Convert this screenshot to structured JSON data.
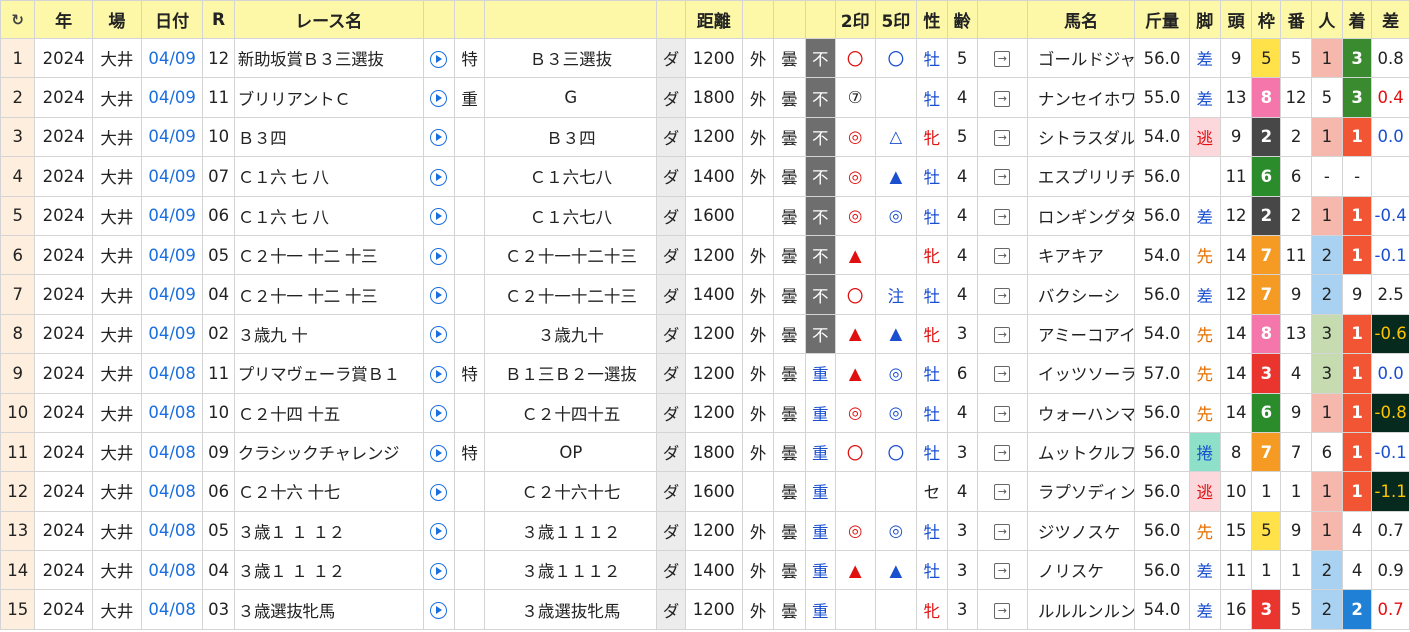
{
  "headers": {
    "refresh": "↻",
    "year": "年",
    "place": "場",
    "date": "日付",
    "race_no": "R",
    "race_name": "レース名",
    "distance": "距離",
    "mark2": "2印",
    "mark5": "5印",
    "sex": "性",
    "age": "齢",
    "horse_name": "馬名",
    "weight": "斤量",
    "leg": "脚",
    "heads": "頭",
    "waku": "枠",
    "ban": "番",
    "ninki": "人",
    "chaku": "着",
    "diff": "差"
  },
  "icons": {
    "play": "play-circle-icon",
    "link": "external-link-icon"
  },
  "rows": [
    {
      "idx": "1",
      "year": "2024",
      "place": "大井",
      "date": "04/09",
      "rno": "12",
      "rname": "新助坂賞Ｂ３三選抜",
      "flag": "特",
      "cls": "Ｂ３三選抜",
      "surf": "ダ",
      "dist": "1200",
      "course": "外",
      "weather": "曇",
      "baba": "不",
      "m2": "〇",
      "m2c": "m-red",
      "m5": "〇",
      "m5c": "m-blue",
      "sex": "牡",
      "age": "5",
      "horse": "ゴールドジャッジ",
      "kin": "56.0",
      "leg": "差",
      "heads": "9",
      "waku": "5",
      "ban": "5",
      "ninki": "1",
      "chaku": "3",
      "diff": "0.8"
    },
    {
      "idx": "2",
      "year": "2024",
      "place": "大井",
      "date": "04/09",
      "rno": "11",
      "rname": "ブリリアントＣ",
      "flag": "重",
      "cls": "G",
      "surf": "ダ",
      "dist": "1800",
      "course": "外",
      "weather": "曇",
      "baba": "不",
      "m2": "⑦",
      "m2c": "",
      "m5": "",
      "m5c": "",
      "sex": "牡",
      "age": "4",
      "horse": "ナンセイホワイト",
      "kin": "55.0",
      "leg": "差",
      "heads": "13",
      "waku": "8",
      "ban": "12",
      "ninki": "5",
      "chaku": "3",
      "diff": "0.4"
    },
    {
      "idx": "3",
      "year": "2024",
      "place": "大井",
      "date": "04/09",
      "rno": "10",
      "rname": "Ｂ３四",
      "flag": "",
      "cls": "Ｂ３四",
      "surf": "ダ",
      "dist": "1200",
      "course": "外",
      "weather": "曇",
      "baba": "不",
      "m2": "◎",
      "m2c": "m-red",
      "m5": "△",
      "m5c": "m-blue",
      "sex": "牝",
      "age": "5",
      "horse": "シトラスダル",
      "kin": "54.0",
      "leg": "逃",
      "heads": "9",
      "waku": "2",
      "ban": "2",
      "ninki": "1",
      "chaku": "1",
      "diff": "0.0"
    },
    {
      "idx": "4",
      "year": "2024",
      "place": "大井",
      "date": "04/09",
      "rno": "07",
      "rname": "Ｃ１六 七 八",
      "flag": "",
      "cls": "Ｃ１六七八",
      "surf": "ダ",
      "dist": "1400",
      "course": "外",
      "weather": "曇",
      "baba": "不",
      "m2": "◎",
      "m2c": "m-red",
      "m5": "▲",
      "m5c": "m-blue",
      "sex": "牡",
      "age": "4",
      "horse": "エスプリリチャード",
      "kin": "56.0",
      "leg": "",
      "heads": "11",
      "waku": "6",
      "ban": "6",
      "ninki": "-",
      "chaku": "-",
      "diff": ""
    },
    {
      "idx": "5",
      "year": "2024",
      "place": "大井",
      "date": "04/09",
      "rno": "06",
      "rname": "Ｃ１六 七 八",
      "flag": "",
      "cls": "Ｃ１六七八",
      "surf": "ダ",
      "dist": "1600",
      "course": "",
      "weather": "曇",
      "baba": "不",
      "m2": "◎",
      "m2c": "m-red",
      "m5": "◎",
      "m5c": "m-blue",
      "sex": "牡",
      "age": "4",
      "horse": "ロンギングタイム",
      "kin": "56.0",
      "leg": "差",
      "heads": "12",
      "waku": "2",
      "ban": "2",
      "ninki": "1",
      "chaku": "1",
      "diff": "-0.4"
    },
    {
      "idx": "6",
      "year": "2024",
      "place": "大井",
      "date": "04/09",
      "rno": "05",
      "rname": "Ｃ２十一 十二 十三",
      "flag": "",
      "cls": "Ｃ２十一十二十三",
      "surf": "ダ",
      "dist": "1200",
      "course": "外",
      "weather": "曇",
      "baba": "不",
      "m2": "▲",
      "m2c": "m-red",
      "m5": "",
      "m5c": "",
      "sex": "牝",
      "age": "4",
      "horse": "キアキア",
      "kin": "54.0",
      "leg": "先",
      "heads": "14",
      "waku": "7",
      "ban": "11",
      "ninki": "2",
      "chaku": "1",
      "diff": "-0.1"
    },
    {
      "idx": "7",
      "year": "2024",
      "place": "大井",
      "date": "04/09",
      "rno": "04",
      "rname": "Ｃ２十一 十二 十三",
      "flag": "",
      "cls": "Ｃ２十一十二十三",
      "surf": "ダ",
      "dist": "1400",
      "course": "外",
      "weather": "曇",
      "baba": "不",
      "m2": "〇",
      "m2c": "m-red",
      "m5": "注",
      "m5c": "m-blue",
      "sex": "牡",
      "age": "4",
      "horse": "バクシーシ",
      "kin": "56.0",
      "leg": "差",
      "heads": "12",
      "waku": "7",
      "ban": "9",
      "ninki": "2",
      "chaku": "9",
      "diff": "2.5"
    },
    {
      "idx": "8",
      "year": "2024",
      "place": "大井",
      "date": "04/09",
      "rno": "02",
      "rname": "３歳九 十",
      "flag": "",
      "cls": "３歳九十",
      "surf": "ダ",
      "dist": "1200",
      "course": "外",
      "weather": "曇",
      "baba": "不",
      "m2": "▲",
      "m2c": "m-red",
      "m5": "▲",
      "m5c": "m-blue",
      "sex": "牝",
      "age": "3",
      "horse": "アミーコアイドル",
      "kin": "54.0",
      "leg": "先",
      "heads": "14",
      "waku": "8",
      "ban": "13",
      "ninki": "3",
      "chaku": "1",
      "diff": "-0.6"
    },
    {
      "idx": "9",
      "year": "2024",
      "place": "大井",
      "date": "04/08",
      "rno": "11",
      "rname": "プリマヴェーラ賞Ｂ１",
      "flag": "特",
      "cls": "Ｂ１三Ｂ２一選抜",
      "surf": "ダ",
      "dist": "1200",
      "course": "外",
      "weather": "曇",
      "baba": "重",
      "m2": "▲",
      "m2c": "m-red",
      "m5": "◎",
      "m5c": "m-blue",
      "sex": "牡",
      "age": "6",
      "horse": "イッツソーラッド",
      "kin": "57.0",
      "leg": "先",
      "heads": "14",
      "waku": "3",
      "ban": "4",
      "ninki": "3",
      "chaku": "1",
      "diff": "0.0"
    },
    {
      "idx": "10",
      "year": "2024",
      "place": "大井",
      "date": "04/08",
      "rno": "10",
      "rname": "Ｃ２十四 十五",
      "flag": "",
      "cls": "Ｃ２十四十五",
      "surf": "ダ",
      "dist": "1200",
      "course": "外",
      "weather": "曇",
      "baba": "重",
      "m2": "◎",
      "m2c": "m-red",
      "m5": "◎",
      "m5c": "m-blue",
      "sex": "牡",
      "age": "4",
      "horse": "ウォーハンマー",
      "kin": "56.0",
      "leg": "先",
      "heads": "14",
      "waku": "6",
      "ban": "9",
      "ninki": "1",
      "chaku": "1",
      "diff": "-0.8"
    },
    {
      "idx": "11",
      "year": "2024",
      "place": "大井",
      "date": "04/08",
      "rno": "09",
      "rname": "クラシックチャレンジ",
      "flag": "特",
      "cls": "OP",
      "surf": "ダ",
      "dist": "1800",
      "course": "外",
      "weather": "曇",
      "baba": "重",
      "m2": "〇",
      "m2c": "m-red",
      "m5": "〇",
      "m5c": "m-blue",
      "sex": "牡",
      "age": "3",
      "horse": "ムットクルフェ",
      "kin": "56.0",
      "leg": "捲",
      "heads": "8",
      "waku": "7",
      "ban": "7",
      "ninki": "6",
      "chaku": "1",
      "diff": "-0.1"
    },
    {
      "idx": "12",
      "year": "2024",
      "place": "大井",
      "date": "04/08",
      "rno": "06",
      "rname": "Ｃ２十六 十七",
      "flag": "",
      "cls": "Ｃ２十六十七",
      "surf": "ダ",
      "dist": "1600",
      "course": "",
      "weather": "曇",
      "baba": "重",
      "m2": "",
      "m2c": "",
      "m5": "",
      "m5c": "",
      "sex": "セ",
      "age": "4",
      "horse": "ラプソディンブルー",
      "kin": "56.0",
      "leg": "逃",
      "heads": "10",
      "waku": "1",
      "ban": "1",
      "ninki": "1",
      "chaku": "1",
      "diff": "-1.1"
    },
    {
      "idx": "13",
      "year": "2024",
      "place": "大井",
      "date": "04/08",
      "rno": "05",
      "rname": "３歳１ １ １２",
      "flag": "",
      "cls": "３歳１１１２",
      "surf": "ダ",
      "dist": "1200",
      "course": "外",
      "weather": "曇",
      "baba": "重",
      "m2": "◎",
      "m2c": "m-red",
      "m5": "◎",
      "m5c": "m-blue",
      "sex": "牡",
      "age": "3",
      "horse": "ジツノスケ",
      "kin": "56.0",
      "leg": "先",
      "heads": "15",
      "waku": "5",
      "ban": "9",
      "ninki": "1",
      "chaku": "4",
      "diff": "0.7"
    },
    {
      "idx": "14",
      "year": "2024",
      "place": "大井",
      "date": "04/08",
      "rno": "04",
      "rname": "３歳１ １ １２",
      "flag": "",
      "cls": "３歳１１１２",
      "surf": "ダ",
      "dist": "1400",
      "course": "外",
      "weather": "曇",
      "baba": "重",
      "m2": "▲",
      "m2c": "m-red",
      "m5": "▲",
      "m5c": "m-blue",
      "sex": "牡",
      "age": "3",
      "horse": "ノリスケ",
      "kin": "56.0",
      "leg": "差",
      "heads": "11",
      "waku": "1",
      "ban": "1",
      "ninki": "2",
      "chaku": "4",
      "diff": "0.9"
    },
    {
      "idx": "15",
      "year": "2024",
      "place": "大井",
      "date": "04/08",
      "rno": "03",
      "rname": "３歳選抜牝馬",
      "flag": "",
      "cls": "３歳選抜牝馬",
      "surf": "ダ",
      "dist": "1200",
      "course": "外",
      "weather": "曇",
      "baba": "重",
      "m2": "",
      "m2c": "",
      "m5": "",
      "m5c": "",
      "sex": "牝",
      "age": "3",
      "horse": "ルルルンルン",
      "kin": "54.0",
      "leg": "差",
      "heads": "16",
      "waku": "3",
      "ban": "5",
      "ninki": "2",
      "chaku": "2",
      "diff": "0.7"
    }
  ]
}
